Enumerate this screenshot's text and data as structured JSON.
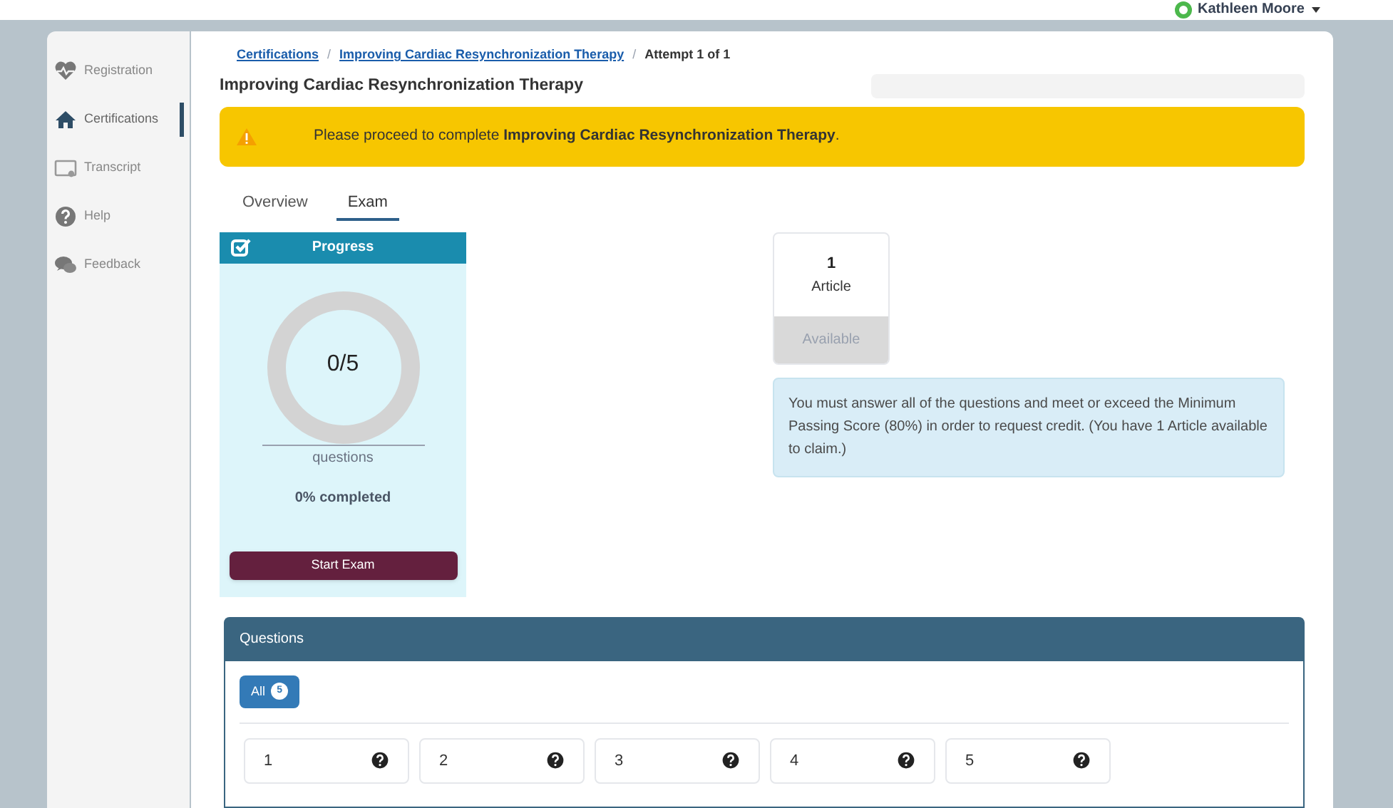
{
  "user": {
    "name": "Kathleen Moore",
    "online": true
  },
  "sidebar": {
    "items": [
      {
        "label": "Registration",
        "selected": false
      },
      {
        "label": "Certifications",
        "selected": true
      },
      {
        "label": "Transcript",
        "selected": false
      },
      {
        "label": "Help",
        "selected": false
      },
      {
        "label": "Feedback",
        "selected": false
      }
    ]
  },
  "breadcrumb_separator": "/",
  "breadcrumbs": [
    {
      "label": "Certifications",
      "link": true
    },
    {
      "label": "Improving Cardiac Resynchronization Therapy",
      "link": true
    },
    {
      "label": "Attempt 1 of 1",
      "link": false
    }
  ],
  "page_title": "Improving Cardiac Resynchronization Therapy",
  "alert": {
    "text": "Please proceed to complete **Improving Cardiac Resynchronization Therapy**."
  },
  "tabs": [
    {
      "label": "Overview",
      "selected": false
    },
    {
      "label": "Exam",
      "selected": true
    }
  ],
  "progress": {
    "title": "Progress",
    "count": "0/5",
    "level": 0,
    "unit": "questions",
    "percent": "0% completed",
    "button": "Start Exam"
  },
  "article": {
    "number": "1",
    "label": "Article",
    "status": "Available"
  },
  "info": "You must answer all of the questions and meet or exceed the Minimum Passing Score (80%) in order to request credit. (You have 1 Article available to claim.)",
  "questions": {
    "title": "Questions",
    "filter": {
      "label": "All",
      "count": "5"
    },
    "items": [
      {
        "label": "1"
      },
      {
        "label": "2"
      },
      {
        "label": "3"
      },
      {
        "label": "4"
      },
      {
        "label": "5"
      }
    ]
  }
}
